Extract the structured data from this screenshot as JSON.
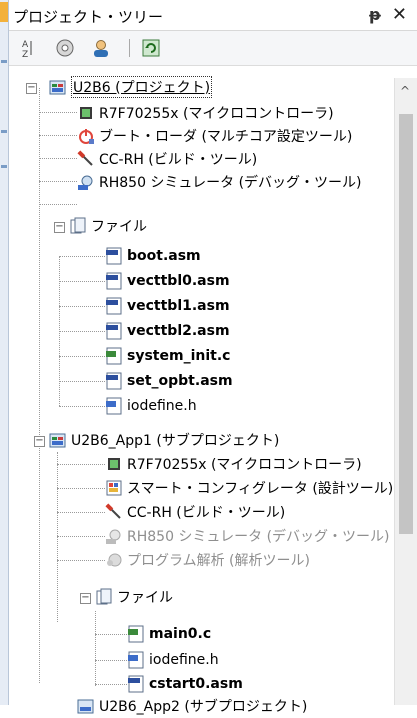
{
  "panel": {
    "title": "プロジェクト・ツリー",
    "pin_glyph": "ᵽ",
    "close_glyph": "✕"
  },
  "toolbar": {
    "sort_icon": "sort-icon",
    "properties_icon": "properties-icon",
    "user_icon": "user-icon",
    "refresh_icon": "refresh-icon"
  },
  "tree": {
    "project": "U2B6 (プロジェクト)",
    "mcu": "R7F70255x (マイクロコントローラ)",
    "bootloader": "ブート・ローダ (マルチコア設定ツール)",
    "ccrh": "CC-RH (ビルド・ツール)",
    "sim": "RH850 シミュレータ (デバッグ・ツール)",
    "file_folder": "ファイル",
    "files": [
      "boot.asm",
      "vecttbl0.asm",
      "vecttbl1.asm",
      "vecttbl2.asm",
      "system_init.c",
      "set_opbt.asm",
      "iodefine.h"
    ],
    "sub_project": "U2B6_App1 (サブプロジェクト)",
    "sub_mcu": "R7F70255x (マイクロコントローラ)",
    "sub_smart": "スマート・コンフィグレータ (設計ツール)",
    "sub_ccrh": "CC-RH (ビルド・ツール)",
    "sub_sim": "RH850 シミュレータ (デバッグ・ツール)",
    "sub_analysis": "プログラム解析 (解析ツール)",
    "sub_file_folder": "ファイル",
    "sub_files": [
      "main0.c",
      "iodefine.h",
      "cstart0.asm"
    ],
    "next_partial": "U2B6_App2 (サブプロジェクト)"
  }
}
